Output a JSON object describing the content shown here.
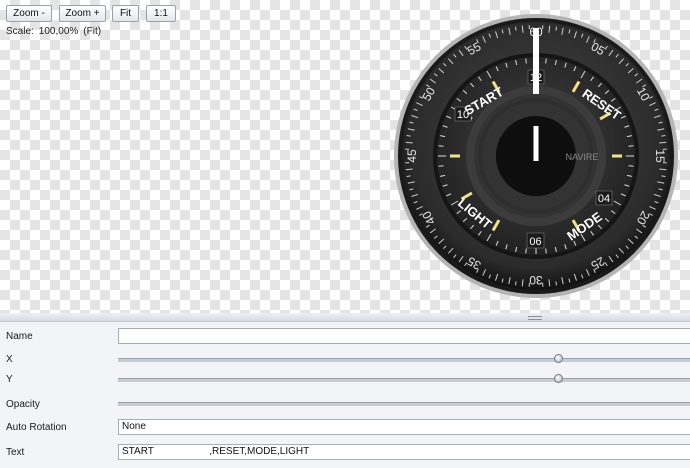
{
  "toolbar": {
    "zoom_out_label": "Zoom -",
    "zoom_in_label": "Zoom +",
    "fit_label": "Fit",
    "one_to_one_label": "1:1"
  },
  "scale": {
    "label": "Scale:",
    "value": "100,00%",
    "mode": "(Fit)"
  },
  "watch": {
    "bezel_numbers": [
      "60",
      "05",
      "10",
      "15",
      "20",
      "25",
      "30",
      "35",
      "40",
      "45",
      "50",
      "55"
    ],
    "hour_markers": [
      "12",
      "04",
      "06",
      "10"
    ],
    "pusher_labels": [
      "START",
      "RESET",
      "MODE",
      "LIGHT"
    ],
    "brand_text": "NAVIRE",
    "hand_color": "#ffffff",
    "index_color": "#f0e28a",
    "dial_color": "#2a2a2a"
  },
  "properties": {
    "name": {
      "label": "Name",
      "value": ""
    },
    "x": {
      "label": "X",
      "level": 0.77
    },
    "y": {
      "label": "Y",
      "level": 0.77
    },
    "opacity": {
      "label": "Opacity"
    },
    "auto_rotation": {
      "label": "Auto Rotation",
      "value": "None"
    },
    "text": {
      "label": "Text",
      "value": "START                    ,RESET,MODE,LIGHT"
    }
  }
}
